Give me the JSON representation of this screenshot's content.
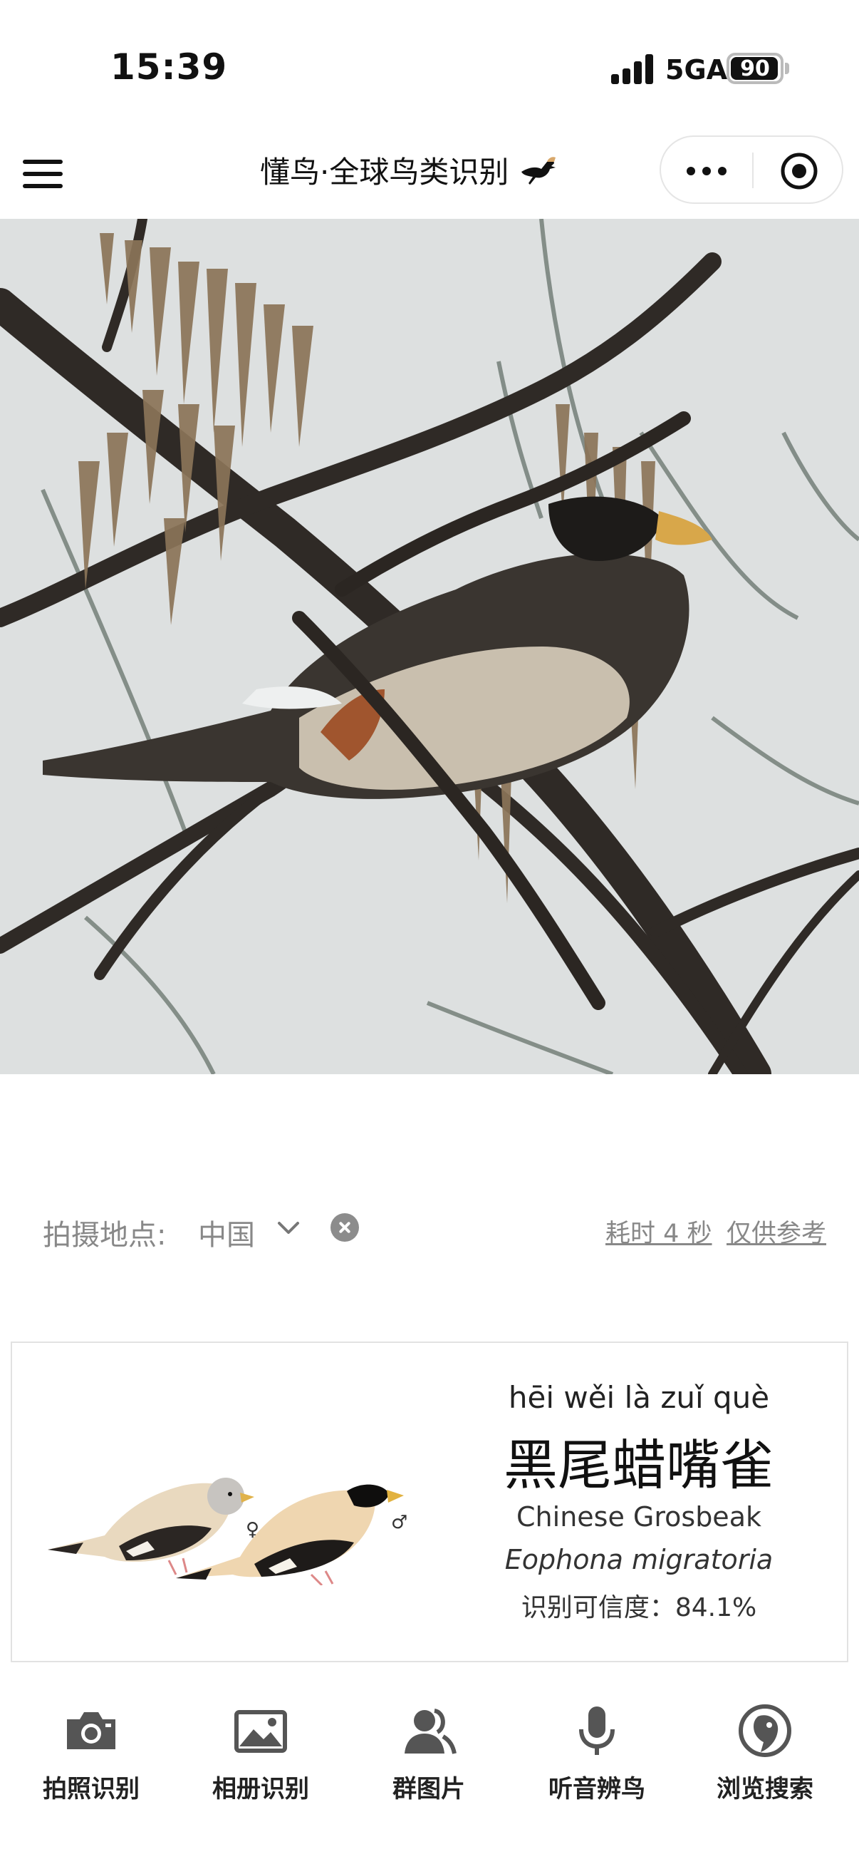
{
  "status_bar": {
    "time": "15:39",
    "network": "5GA",
    "battery": "90",
    "battery_level": 0.9
  },
  "nav": {
    "title": "懂鸟·全球鸟类识别"
  },
  "location": {
    "label": "拍摄地点:",
    "value": "中国",
    "time_taken": "耗时 4 秒",
    "reference_note": "仅供参考"
  },
  "result": {
    "pinyin": "hēi wěi là zuǐ què",
    "chinese_name": "黑尾蜡嘴雀",
    "english_name": "Chinese Grosbeak",
    "latin_name": "Eophona migratoria",
    "confidence": "识别可信度：84.1%",
    "female_symbol": "♀",
    "male_symbol": "♂"
  },
  "tabs": [
    {
      "label": "拍照识别",
      "icon": "camera-icon"
    },
    {
      "label": "相册识别",
      "icon": "album-icon"
    },
    {
      "label": "群图片",
      "icon": "group-icon"
    },
    {
      "label": "听音辨鸟",
      "icon": "microphone-icon"
    },
    {
      "label": "浏览搜索",
      "icon": "bird-search-icon"
    }
  ],
  "colors": {
    "sky": "#dde0e0",
    "text_primary": "#111111",
    "text_muted": "#888888",
    "card_border": "#e2e2e2"
  }
}
